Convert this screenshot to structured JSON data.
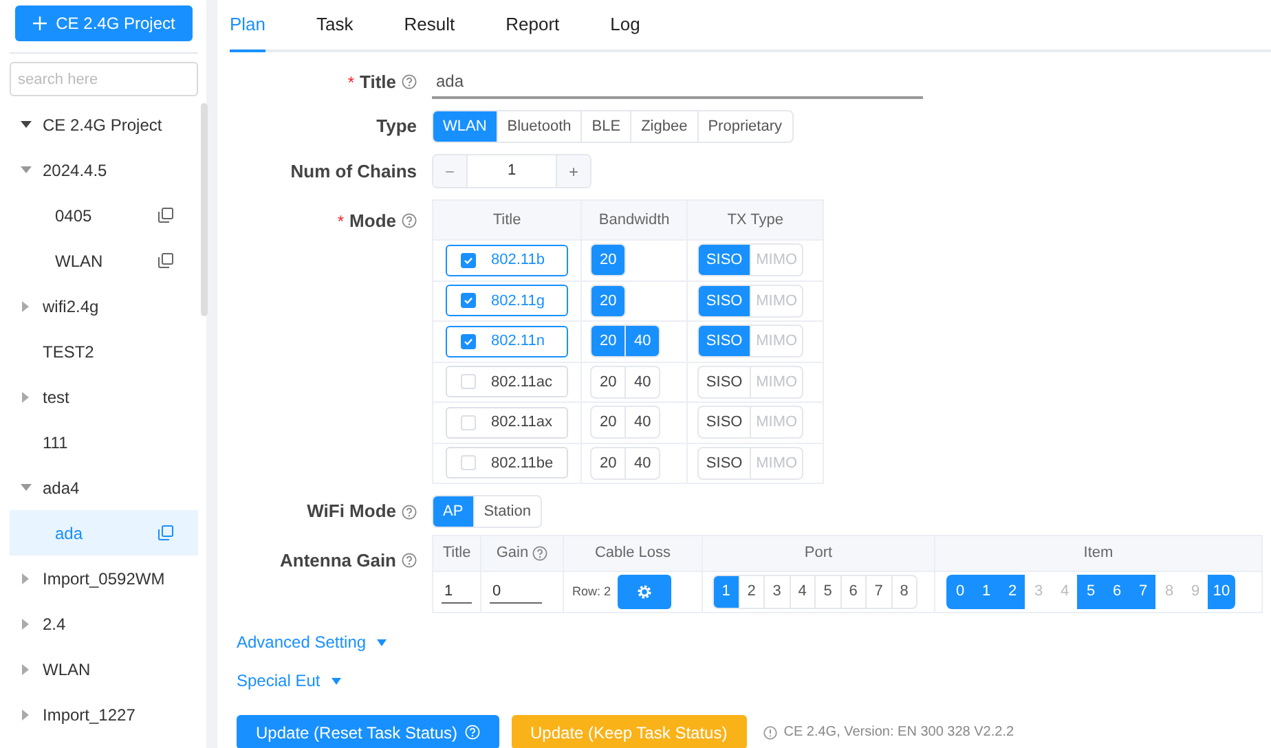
{
  "sidebar": {
    "new_button": "CE 2.4G Project",
    "search": {
      "placeholder": "search here"
    },
    "tree": [
      {
        "label": "CE 2.4G Project",
        "expanded": true,
        "selected": false
      },
      {
        "label": "2024.4.5",
        "expanded": true,
        "selected": false,
        "children": [
          {
            "label": "0405",
            "selected": false,
            "copy": true
          },
          {
            "label": "WLAN",
            "selected": false,
            "copy": true
          }
        ]
      },
      {
        "label": "wifi2.4g",
        "expanded": false,
        "selected": false
      },
      {
        "label": "TEST2",
        "selected": false
      },
      {
        "label": "test",
        "expanded": false,
        "selected": false
      },
      {
        "label": "111",
        "selected": false
      },
      {
        "label": "ada4",
        "expanded": true,
        "selected": false,
        "children": [
          {
            "label": "ada",
            "selected": true,
            "copy": true
          }
        ]
      },
      {
        "label": "Import_0592WM",
        "expanded": false,
        "selected": false
      },
      {
        "label": "2.4",
        "expanded": false,
        "selected": false
      },
      {
        "label": "WLAN",
        "expanded": false,
        "selected": false
      },
      {
        "label": "Import_1227",
        "expanded": false,
        "selected": false
      }
    ]
  },
  "tabs": [
    {
      "label": "Plan",
      "selected": true
    },
    {
      "label": "Task",
      "selected": false
    },
    {
      "label": "Result",
      "selected": false
    },
    {
      "label": "Report",
      "selected": false
    },
    {
      "label": "Log",
      "selected": false
    }
  ],
  "form": {
    "title": {
      "label": "Title",
      "required": "*",
      "help": true,
      "value": "ada"
    },
    "type": {
      "label": "Type",
      "options": [
        {
          "label": "WLAN",
          "selected": true
        },
        {
          "label": "Bluetooth",
          "selected": false
        },
        {
          "label": "BLE",
          "selected": false
        },
        {
          "label": "Zigbee",
          "selected": false
        },
        {
          "label": "Proprietary",
          "selected": false
        }
      ]
    },
    "chains": {
      "label": "Num of Chains",
      "minus": "−",
      "value": "1",
      "plus": "+",
      "minus_disabled": true
    },
    "mode": {
      "label": "Mode",
      "required": "*",
      "help": true,
      "columns": [
        "Title",
        "Bandwidth",
        "TX Type"
      ],
      "rows": [
        {
          "title": "802.11b",
          "checked": true,
          "bandwidth": [
            {
              "label": "20",
              "selected": true
            }
          ],
          "tx": [
            {
              "label": "SISO",
              "selected": true,
              "disabled": false
            },
            {
              "label": "MIMO",
              "selected": false,
              "disabled": true
            }
          ]
        },
        {
          "title": "802.11g",
          "checked": true,
          "bandwidth": [
            {
              "label": "20",
              "selected": true
            }
          ],
          "tx": [
            {
              "label": "SISO",
              "selected": true,
              "disabled": false
            },
            {
              "label": "MIMO",
              "selected": false,
              "disabled": true
            }
          ]
        },
        {
          "title": "802.11n",
          "checked": true,
          "bandwidth": [
            {
              "label": "20",
              "selected": true
            },
            {
              "label": "40",
              "selected": true
            }
          ],
          "tx": [
            {
              "label": "SISO",
              "selected": true,
              "disabled": false
            },
            {
              "label": "MIMO",
              "selected": false,
              "disabled": true
            }
          ]
        },
        {
          "title": "802.11ac",
          "checked": false,
          "bandwidth": [
            {
              "label": "20",
              "selected": false
            },
            {
              "label": "40",
              "selected": false
            }
          ],
          "tx": [
            {
              "label": "SISO",
              "selected": false,
              "disabled": false
            },
            {
              "label": "MIMO",
              "selected": false,
              "disabled": true
            }
          ]
        },
        {
          "title": "802.11ax",
          "checked": false,
          "bandwidth": [
            {
              "label": "20",
              "selected": false
            },
            {
              "label": "40",
              "selected": false
            }
          ],
          "tx": [
            {
              "label": "SISO",
              "selected": false,
              "disabled": false
            },
            {
              "label": "MIMO",
              "selected": false,
              "disabled": true
            }
          ]
        },
        {
          "title": "802.11be",
          "checked": false,
          "bandwidth": [
            {
              "label": "20",
              "selected": false
            },
            {
              "label": "40",
              "selected": false
            }
          ],
          "tx": [
            {
              "label": "SISO",
              "selected": false,
              "disabled": false
            },
            {
              "label": "MIMO",
              "selected": false,
              "disabled": true
            }
          ]
        }
      ]
    },
    "wifi_mode": {
      "label": "WiFi Mode",
      "help": true,
      "options": [
        {
          "label": "AP",
          "selected": true
        },
        {
          "label": "Station",
          "selected": false
        }
      ]
    },
    "antenna": {
      "label": "Antenna Gain",
      "help": true,
      "columns": [
        {
          "label": "Title",
          "help": false
        },
        {
          "label": "Gain",
          "help": true
        },
        {
          "label": "Cable Loss",
          "help": false
        },
        {
          "label": "Port",
          "help": false
        },
        {
          "label": "Item",
          "help": false
        }
      ],
      "title_value": "1",
      "gain_value": "0",
      "row_text": "Row: 2",
      "ports": [
        {
          "label": "1",
          "selected": true
        },
        {
          "label": "2",
          "selected": false
        },
        {
          "label": "3",
          "selected": false
        },
        {
          "label": "4",
          "selected": false
        },
        {
          "label": "5",
          "selected": false
        },
        {
          "label": "6",
          "selected": false
        },
        {
          "label": "7",
          "selected": false
        },
        {
          "label": "8",
          "selected": false
        }
      ],
      "items": [
        {
          "label": "0",
          "selected": true
        },
        {
          "label": "1",
          "selected": true
        },
        {
          "label": "2",
          "selected": true
        },
        {
          "label": "3",
          "selected": false
        },
        {
          "label": "4",
          "selected": false
        },
        {
          "label": "5",
          "selected": true
        },
        {
          "label": "6",
          "selected": true
        },
        {
          "label": "7",
          "selected": true
        },
        {
          "label": "8",
          "selected": false
        },
        {
          "label": "9",
          "selected": false
        },
        {
          "label": "10",
          "selected": true
        }
      ]
    }
  },
  "advanced": "Advanced Setting",
  "special": "Special Eut",
  "actions": {
    "reset": "Update (Reset Task Status)",
    "keep": "Update (Keep Task Status)",
    "version": "CE 2.4G, Version: EN 300 328 V2.2.2"
  }
}
